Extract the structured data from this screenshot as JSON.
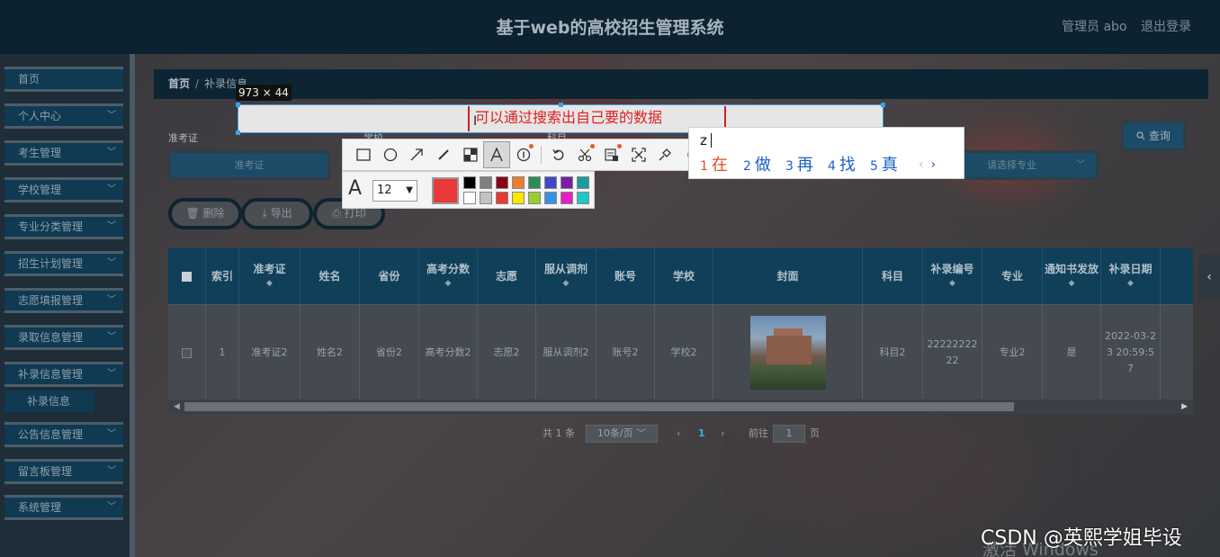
{
  "header": {
    "title": "基于web的高校招生管理系统",
    "admin": "管理员 abo",
    "logout": "退出登录"
  },
  "sidebar": {
    "items": [
      {
        "label": "首页",
        "chevron": false
      },
      {
        "label": "个人中心",
        "chevron": true
      },
      {
        "label": "考生管理",
        "chevron": true
      },
      {
        "label": "学校管理",
        "chevron": true
      },
      {
        "label": "专业分类管理",
        "chevron": true
      },
      {
        "label": "招生计划管理",
        "chevron": true
      },
      {
        "label": "志愿填报管理",
        "chevron": true
      },
      {
        "label": "录取信息管理",
        "chevron": true
      },
      {
        "label": "补录信息管理",
        "chevron": true
      },
      {
        "label": "公告信息管理",
        "chevron": true
      },
      {
        "label": "留言板管理",
        "chevron": true
      },
      {
        "label": "系统管理",
        "chevron": true
      }
    ],
    "active_sub": "补录信息",
    "chevron_glyph": "﹀"
  },
  "breadcrumb": {
    "home": "首页",
    "sep": "/",
    "current": "补录信息"
  },
  "search": {
    "label_ticket": "准考证",
    "ticket_placeholder": "准考证",
    "label_school": "学校",
    "label_subject": "科目",
    "major_placeholder": "请选择专业",
    "query_label": "查询",
    "query_icon": "search-icon"
  },
  "actions": {
    "delete": "删除",
    "export": "导出",
    "print": "打印"
  },
  "table": {
    "headers": [
      "索引",
      "准考证",
      "姓名",
      "省份",
      "高考分数",
      "志愿",
      "服从调剂",
      "账号",
      "学校",
      "封面",
      "科目",
      "补录编号",
      "专业",
      "通知书发放",
      "补录日期"
    ],
    "sort_glyph": "◆",
    "row": {
      "index": "1",
      "ticket": "准考证2",
      "name": "姓名2",
      "province": "省份2",
      "score": "高考分数2",
      "wish": "志愿2",
      "adjust": "服从调剂2",
      "account": "账号2",
      "school": "学校2",
      "subject": "科目2",
      "supp_no": "2222222222",
      "major": "专业2",
      "notice": "是",
      "date": "2022-03-23 20:59:57"
    }
  },
  "pagination": {
    "total": "共 1 条",
    "page_size": "10条/页",
    "current": "1",
    "goto_label": "前往",
    "goto_value": "1",
    "page_unit": "页"
  },
  "screenshot_tool": {
    "size_label": "973 × 44",
    "annotation": "可以通过搜索出自己要的数据",
    "font_size": "12",
    "current_color": "#e83a3a",
    "swatches": [
      "#000000",
      "#7f7f7f",
      "#880015",
      "#ed7d31",
      "#2e8b57",
      "#3f48cc",
      "#7b1fa2",
      "#1a9c9c",
      "#ffffff",
      "#c3c3c3",
      "#e53935",
      "#ffe600",
      "#9acd32",
      "#3a8fe0",
      "#e020c0",
      "#22c7c7"
    ]
  },
  "ime": {
    "composition": "z",
    "candidates": [
      {
        "n": "1",
        "text": "在"
      },
      {
        "n": "2",
        "text": "做"
      },
      {
        "n": "3",
        "text": "再"
      },
      {
        "n": "4",
        "text": "找"
      },
      {
        "n": "5",
        "text": "真"
      }
    ],
    "prev": "‹",
    "next": "›"
  },
  "watermarks": {
    "windows": "激活 Windows",
    "csdn": "CSDN @英熙学姐毕设"
  }
}
